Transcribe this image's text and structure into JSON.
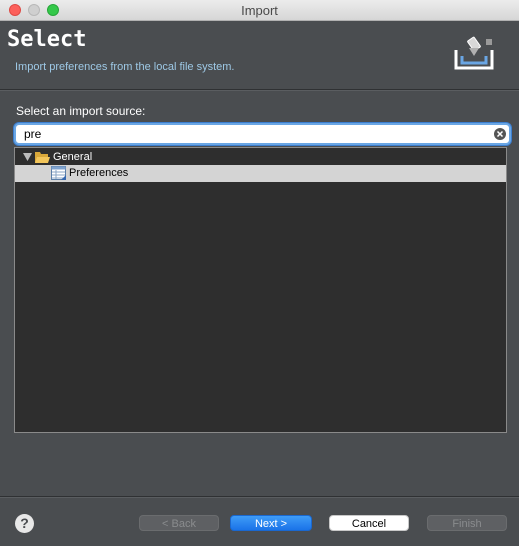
{
  "window": {
    "title": "Import"
  },
  "banner": {
    "heading": "Select",
    "description": "Import preferences from the local file system.",
    "icon": "import-wizard-icon"
  },
  "source": {
    "label": "Select an import source:",
    "filter_value": "pre"
  },
  "tree": {
    "items": [
      {
        "label": "General",
        "icon": "folder-open-icon",
        "expanded": true
      },
      {
        "label": "Preferences",
        "icon": "preferences-icon",
        "selected": true
      }
    ]
  },
  "footer": {
    "help_label": "?",
    "back_label": "< Back",
    "next_label": "Next >",
    "cancel_label": "Cancel",
    "finish_label": "Finish"
  },
  "colors": {
    "background": "#4a4d50",
    "accent": "#1a73e8",
    "description_text": "#9ec9e6"
  }
}
